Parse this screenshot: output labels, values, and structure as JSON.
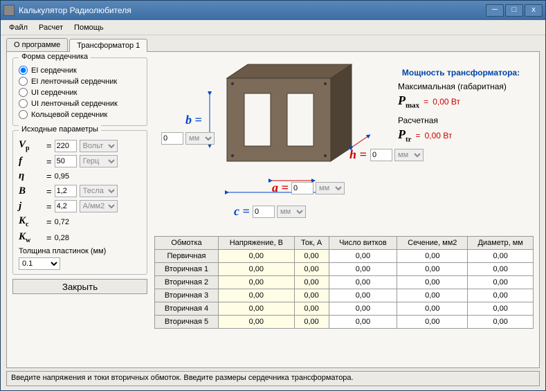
{
  "window": {
    "title": "Калькулятор Радиолюбителя"
  },
  "menu": {
    "file": "Файл",
    "calc": "Расчет",
    "help": "Помощь"
  },
  "tabs": {
    "about": "О программе",
    "trans1": "Трансформатор 1"
  },
  "coreShape": {
    "legend": "Форма сердечника",
    "opts": {
      "ei": "EI сердечник",
      "ei_tape": "EI ленточный сердечник",
      "ui": "UI сердечник",
      "ui_tape": "UI ленточный сердечник",
      "ring": "Кольцевой сердечник"
    }
  },
  "params": {
    "legend": "Исходные параметры",
    "Vp": {
      "sym": "V",
      "sub": "p",
      "val": "220",
      "unit": "Вольт"
    },
    "f": {
      "sym": "f",
      "sub": "",
      "val": "50",
      "unit": "Герц"
    },
    "eta": {
      "sym": "η",
      "sub": "",
      "val": "0,95"
    },
    "B": {
      "sym": "B",
      "sub": "",
      "val": "1,2",
      "unit": "Тесла"
    },
    "j": {
      "sym": "j",
      "sub": "",
      "val": "4,2",
      "unit": "А/мм2"
    },
    "Kc": {
      "sym": "K",
      "sub": "c",
      "val": "0,72"
    },
    "Kw": {
      "sym": "K",
      "sub": "w",
      "val": "0,28"
    }
  },
  "thickness": {
    "label": "Толщина пластинок (мм)",
    "val": "0.1"
  },
  "closeBtn": "Закрыть",
  "dims": {
    "a": {
      "sym": "a =",
      "val": "0",
      "unit": "мм"
    },
    "b": {
      "sym": "b =",
      "val": "0",
      "unit": "мм"
    },
    "c": {
      "sym": "c =",
      "val": "0",
      "unit": "мм"
    },
    "h": {
      "sym": "h =",
      "val": "0",
      "unit": "мм"
    }
  },
  "power": {
    "hdr": "Мощность трансформатора:",
    "max_label": "Максимальная (габаритная)",
    "max_sym": "P",
    "max_sub": "max",
    "max_val": "0,00 Вт",
    "calc_label": "Расчетная",
    "calc_sym": "P",
    "calc_sub": "tr",
    "calc_val": "0,00 Вт"
  },
  "table": {
    "h": {
      "w": "Обмотка",
      "v": "Напряжение, В",
      "i": "Ток, А",
      "n": "Число витков",
      "s": "Сечение, мм2",
      "d": "Диаметр, мм"
    },
    "rows": [
      {
        "name": "Первичная",
        "v": "0,00",
        "i": "0,00",
        "n": "0,00",
        "s": "0,00",
        "d": "0,00"
      },
      {
        "name": "Вторичная 1",
        "v": "0,00",
        "i": "0,00",
        "n": "0,00",
        "s": "0,00",
        "d": "0,00"
      },
      {
        "name": "Вторичная 2",
        "v": "0,00",
        "i": "0,00",
        "n": "0,00",
        "s": "0,00",
        "d": "0,00"
      },
      {
        "name": "Вторичная 3",
        "v": "0,00",
        "i": "0,00",
        "n": "0,00",
        "s": "0,00",
        "d": "0,00"
      },
      {
        "name": "Вторичная 4",
        "v": "0,00",
        "i": "0,00",
        "n": "0,00",
        "s": "0,00",
        "d": "0,00"
      },
      {
        "name": "Вторичная 5",
        "v": "0,00",
        "i": "0,00",
        "n": "0,00",
        "s": "0,00",
        "d": "0,00"
      }
    ]
  },
  "status": "Введите напряжения и токи вторичных обмоток. Введите размеры сердечника трансформатора.",
  "eq": "="
}
